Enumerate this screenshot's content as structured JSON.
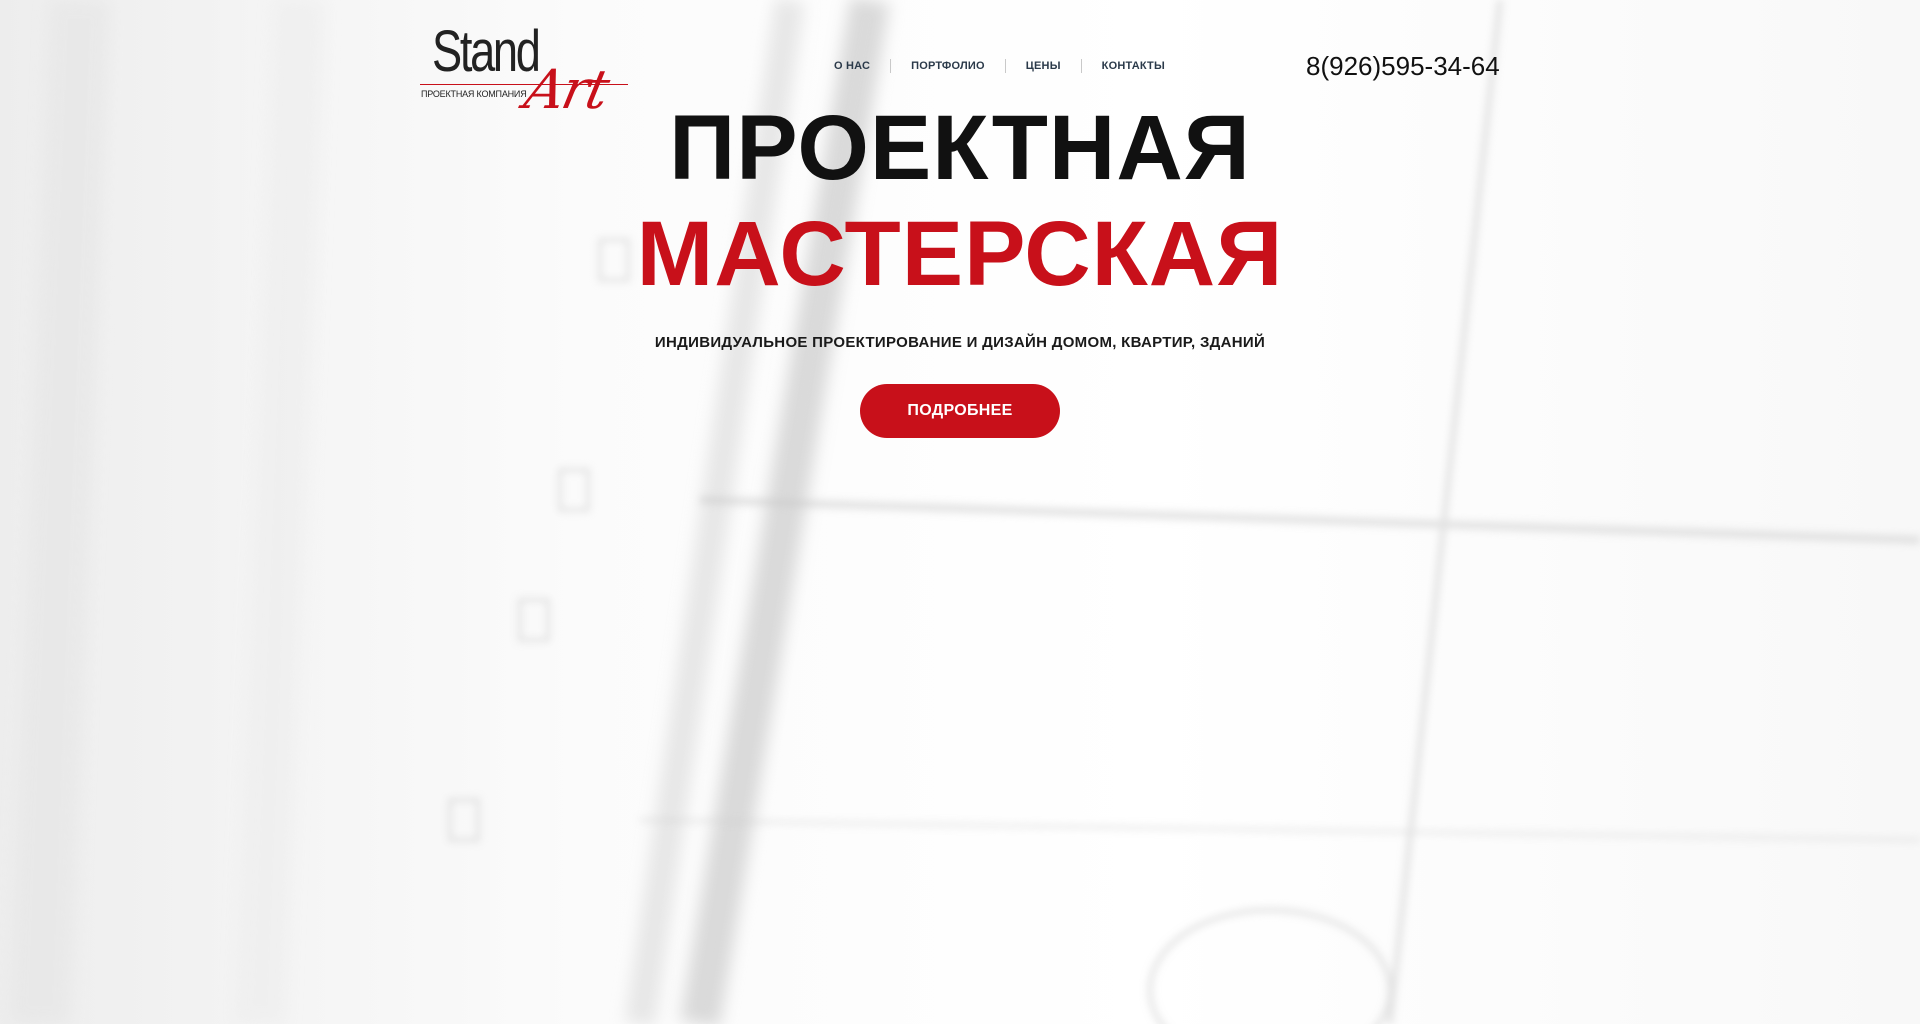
{
  "header": {
    "logo": {
      "word1": "Stand",
      "word2": "Art",
      "subtitle": "ПРОЕКТНАЯ КОМПАНИЯ"
    },
    "nav": [
      {
        "label": "О НАС"
      },
      {
        "label": "ПОРТФОЛИО"
      },
      {
        "label": "ЦЕНЫ"
      },
      {
        "label": "КОНТАКТЫ"
      }
    ],
    "phone": "8(926)595-34-64"
  },
  "hero": {
    "title_line1": "ПРОЕКТНАЯ",
    "title_line2": "МАСТЕРСКАЯ",
    "tagline": "ИНДИВИДУАЛЬНОЕ ПРОЕКТИРОВАНИЕ И ДИЗАЙН ДОМОМ, КВАРТИР, ЗДАНИЙ",
    "cta_label": "ПОДРОБНЕЕ"
  },
  "colors": {
    "accent": "#c8101a",
    "title_dark": "#111111",
    "nav_text": "#2b3a4a"
  }
}
